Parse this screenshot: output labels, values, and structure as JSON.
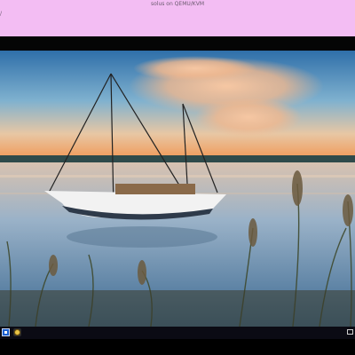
{
  "window": {
    "title": "solus on QEMU/KVM",
    "menu_glyph": "/"
  },
  "desktop": {
    "wallpaper": "sailboat-sunset-wallpaper"
  },
  "taskbar": {
    "start_icon": "start-menu-icon",
    "app_icon": "app-launcher-icon",
    "tray_icon": "display-tray-icon"
  },
  "colors": {
    "title_bar": "#f3bdf3",
    "taskbar": "#0b0b14"
  }
}
